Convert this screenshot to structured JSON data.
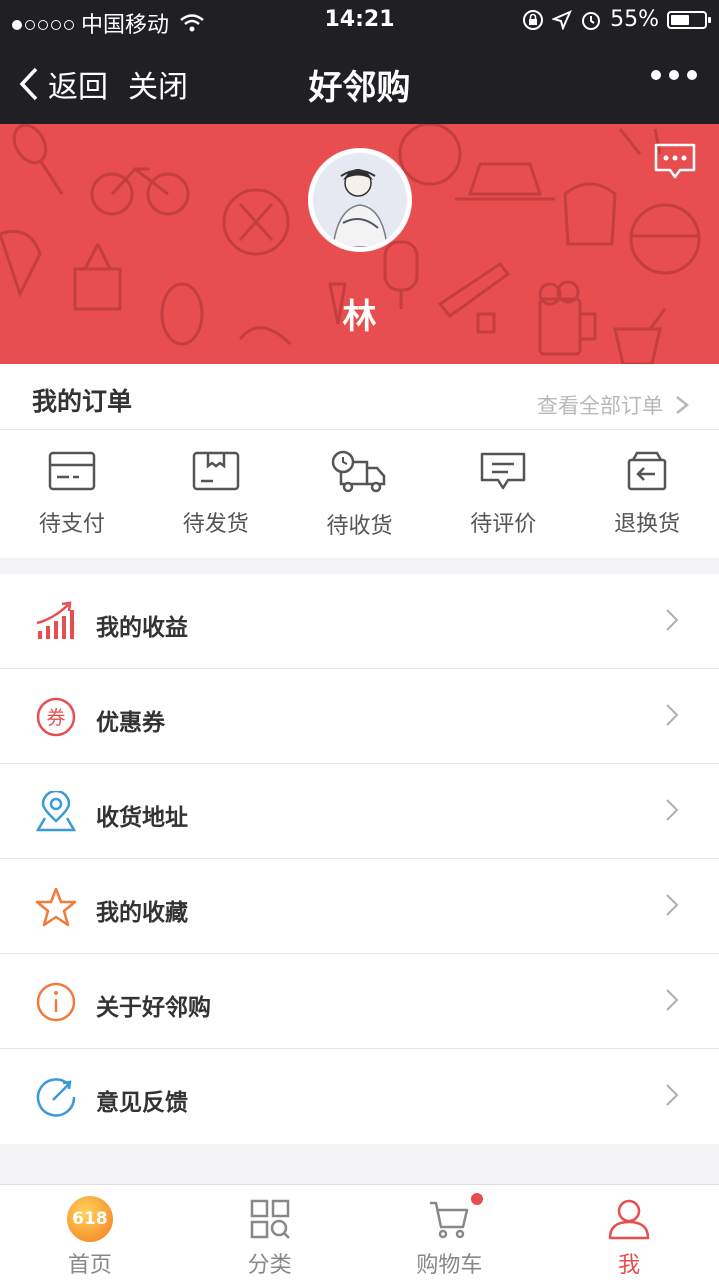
{
  "status_bar": {
    "carrier": "中国移动",
    "time": "14:21",
    "battery": "55%",
    "battery_level": 0.55,
    "signal_bars": 1
  },
  "nav": {
    "back": "返回",
    "close": "关闭",
    "title": "好邻购"
  },
  "profile": {
    "username": "林"
  },
  "orders": {
    "title": "我的订单",
    "view_all": "查看全部订单",
    "items": [
      {
        "label": "待支付",
        "icon": "card-icon"
      },
      {
        "label": "待发货",
        "icon": "box-icon"
      },
      {
        "label": "待收货",
        "icon": "truck-icon"
      },
      {
        "label": "待评价",
        "icon": "comment-icon"
      },
      {
        "label": "退换货",
        "icon": "return-icon"
      }
    ]
  },
  "menu": [
    {
      "label": "我的收益",
      "icon": "income-chart-icon",
      "color": "#e84d4f"
    },
    {
      "label": "优惠券",
      "icon": "coupon-icon",
      "color": "#e84d4f"
    },
    {
      "label": "收货地址",
      "icon": "location-icon",
      "color": "#3a9ad9"
    },
    {
      "label": "我的收藏",
      "icon": "star-icon",
      "color": "#f07b3c"
    },
    {
      "label": "关于好邻购",
      "icon": "info-icon",
      "color": "#f07b3c"
    },
    {
      "label": "意见反馈",
      "icon": "feedback-icon",
      "color": "#3a9ad9"
    }
  ],
  "coupon_glyph": "券",
  "tabs": [
    {
      "label": "首页",
      "badge": "618"
    },
    {
      "label": "分类"
    },
    {
      "label": "购物车"
    },
    {
      "label": "我"
    }
  ],
  "colors": {
    "accent": "#e84d4f",
    "nav_bg": "#1f1f24"
  }
}
